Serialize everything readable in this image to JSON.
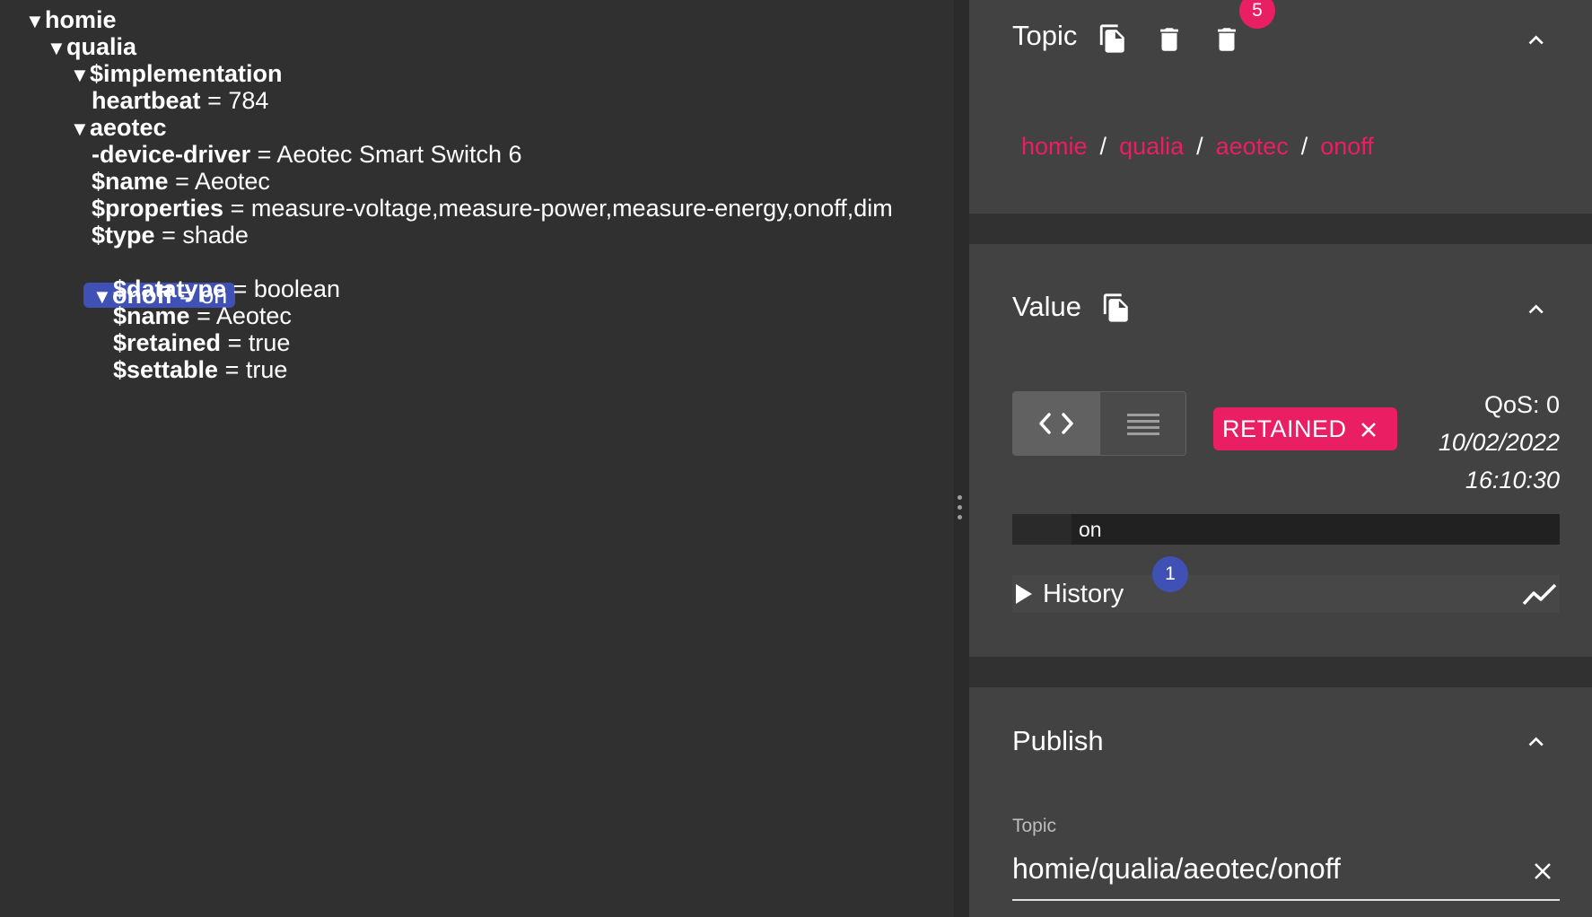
{
  "tree": {
    "rows": [
      {
        "key": "homie",
        "value": "",
        "expanded": true
      },
      {
        "key": "qualia",
        "value": "",
        "expanded": true
      },
      {
        "key": "$implementation",
        "value": "",
        "expanded": true
      },
      {
        "key": "heartbeat",
        "value": "784"
      },
      {
        "key": "aeotec",
        "value": "",
        "expanded": true
      },
      {
        "key": "-device-driver",
        "value": "Aeotec Smart Switch 6"
      },
      {
        "key": "$name",
        "value": "Aeotec"
      },
      {
        "key": "$properties",
        "value": "measure-voltage,measure-power,measure-energy,onoff,dim"
      },
      {
        "key": "$type",
        "value": "shade"
      },
      {
        "key": "onoff",
        "value": "on",
        "expanded": true,
        "selected": true
      },
      {
        "key": "$datatype",
        "value": "boolean"
      },
      {
        "key": "$name",
        "value": "Aeotec"
      },
      {
        "key": "$retained",
        "value": "true"
      },
      {
        "key": "$settable",
        "value": "true"
      }
    ],
    "equals": "=",
    "expanded_glyph": "▼"
  },
  "topic_panel": {
    "title": "Topic",
    "icons": [
      "copy-icon",
      "delete-icon",
      "delete-recursive-icon"
    ],
    "delete_badge": "5",
    "breadcrumb": [
      "homie",
      "qualia",
      "aeotec",
      "onoff"
    ],
    "separator": "/"
  },
  "value_panel": {
    "title": "Value",
    "retained_label": "RETAINED",
    "qos": "QoS: 0",
    "date": "10/02/2022",
    "time": "16:10:30",
    "payload": "on",
    "history_label": "History",
    "history_badge": "1"
  },
  "publish_panel": {
    "title": "Publish",
    "topic_label": "Topic",
    "topic_value": "homie/qualia/aeotec/onoff"
  },
  "colors": {
    "accent": "#e91e63",
    "selection": "#3f51b5",
    "panel": "#424242",
    "background": "#303030"
  }
}
